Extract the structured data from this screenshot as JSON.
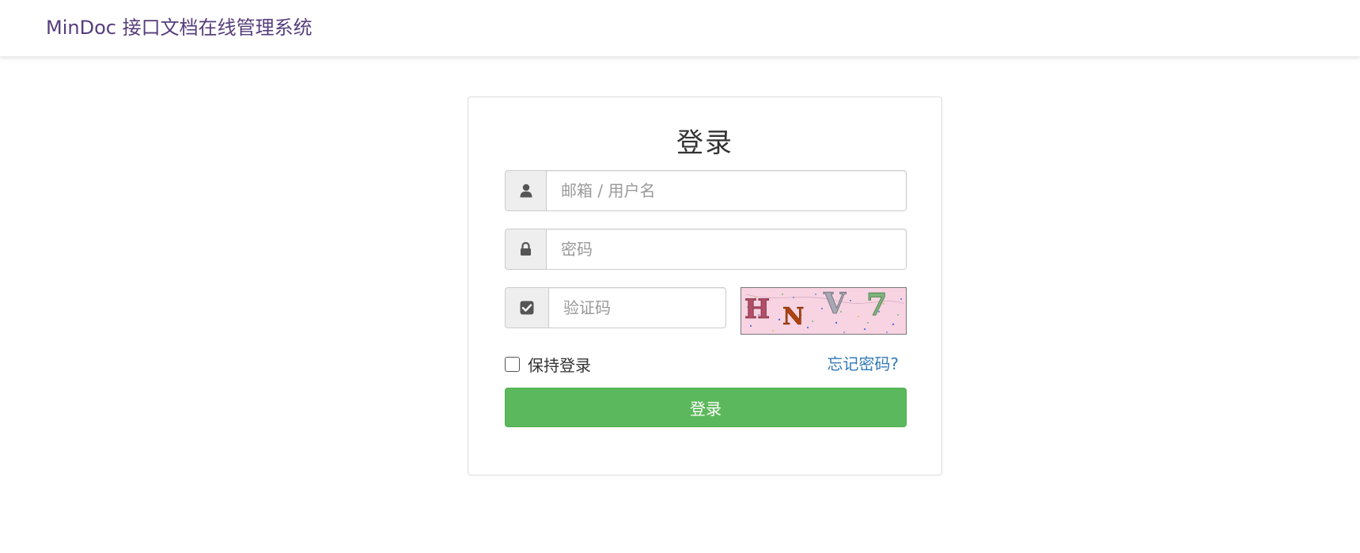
{
  "navbar": {
    "brand": "MinDoc 接口文档在线管理系统"
  },
  "login": {
    "title": "登录",
    "username_placeholder": "邮箱 / 用户名",
    "password_placeholder": "密码",
    "captcha_placeholder": "验证码",
    "captcha_text": "HNV7",
    "remember_label": "保持登录",
    "forgot_label": "忘记密码?",
    "submit_label": "登录"
  },
  "icons": {
    "username": "user-icon",
    "password": "lock-icon",
    "captcha": "check-square-icon"
  },
  "colors": {
    "brand": "#563d7c",
    "primary_button": "#5cb85c",
    "link": "#337ab7",
    "captcha_background": "#f8d4e2"
  }
}
